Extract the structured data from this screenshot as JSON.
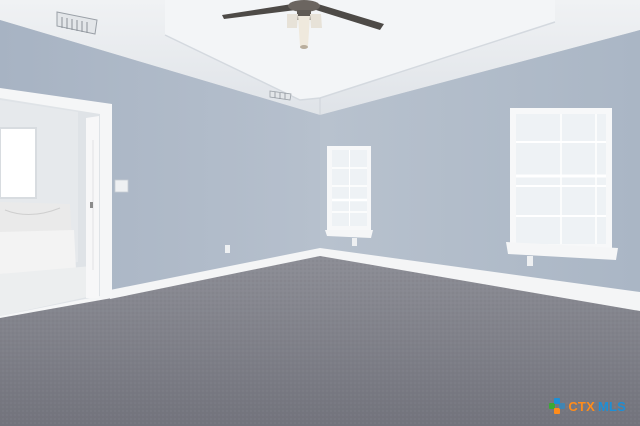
{
  "scene": {
    "description_tag": "empty-bedroom-interior",
    "colors": {
      "wall": "#a9b6c6",
      "wall_right": "#b2bdcb",
      "ceiling": "#e9ecef",
      "carpet": "#7f8088",
      "trim": "#f4f5f6",
      "window_glass": "#eef2f5"
    }
  },
  "watermark": {
    "brand_a": "CTX",
    "brand_b": "MLS",
    "colors": {
      "ctx": "#ff8c1a",
      "mls": "#1d8fd6",
      "logo_green": "#3aa935",
      "logo_blue": "#1d8fd6",
      "logo_orange": "#ff8c1a"
    }
  }
}
